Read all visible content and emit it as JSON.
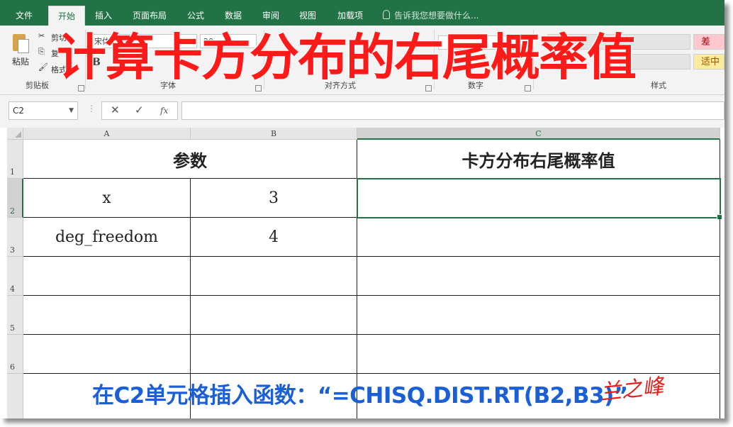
{
  "ribbon": {
    "tabs": [
      "文件",
      "开始",
      "插入",
      "页面布局",
      "公式",
      "数据",
      "审阅",
      "视图",
      "加载项"
    ],
    "active_tab": "开始",
    "tell_me": "告诉我您想要做什么...",
    "clipboard": {
      "paste": "粘贴",
      "cut": "剪切",
      "copy": "复",
      "format": "格式",
      "label": "剪贴板"
    },
    "font": {
      "name": "宋体",
      "size": "20",
      "label": "字体",
      "bold": "B"
    },
    "alignment_label": "对齐方式",
    "number_label": "数字",
    "styles_label": "样式",
    "styles": [
      "差",
      "适中"
    ]
  },
  "overlay_title": "计算卡方分布的右尾概率值",
  "formula_bar": {
    "name_box": "C2",
    "cancel": "✕",
    "enter": "✓",
    "fx": "fx",
    "formula": ""
  },
  "grid": {
    "columns": [
      "A",
      "B",
      "C"
    ],
    "selected_column": "C",
    "rows": [
      "1",
      "2",
      "3",
      "4",
      "5",
      "6"
    ],
    "selected_row": "2",
    "header_ab": "参数",
    "header_c": "卡方分布右尾概率值",
    "cells": {
      "A2": "x",
      "B2": "3",
      "A3": "deg_freedom",
      "B3": "4"
    }
  },
  "caption": "在C2单元格插入函数：“=CHISQ.DIST.RT(B2,B3)”",
  "signature": "兰之峰"
}
